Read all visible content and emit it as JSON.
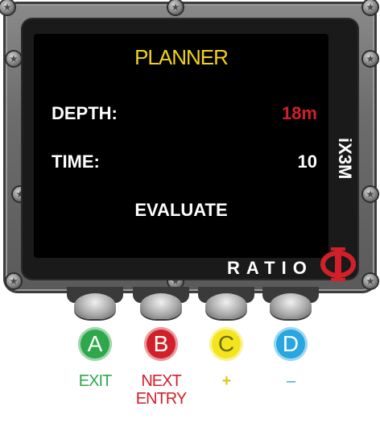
{
  "screen": {
    "title": "PLANNER",
    "depth_label": "DEPTH:",
    "depth_value": "18m",
    "time_label": "TIME:",
    "time_value": "10",
    "evaluate_label": "EVALUATE"
  },
  "device": {
    "model": "iX3M",
    "brand": "RATIO"
  },
  "buttons": [
    {
      "letter": "A",
      "color": "#2ea84a",
      "action": "EXIT",
      "action_color": "#2ea84a"
    },
    {
      "letter": "B",
      "color": "#d1202a",
      "action": "NEXT\nENTRY",
      "action_color": "#d1202a"
    },
    {
      "letter": "C",
      "color": "#f4e41e",
      "action": "+",
      "action_color": "#e0c81a"
    },
    {
      "letter": "D",
      "color": "#27a6df",
      "action": "–",
      "action_color": "#27a6df"
    }
  ],
  "colors": {
    "title": "#f2d21a",
    "depth_value": "#d1202a",
    "logo_red": "#d1202a"
  }
}
